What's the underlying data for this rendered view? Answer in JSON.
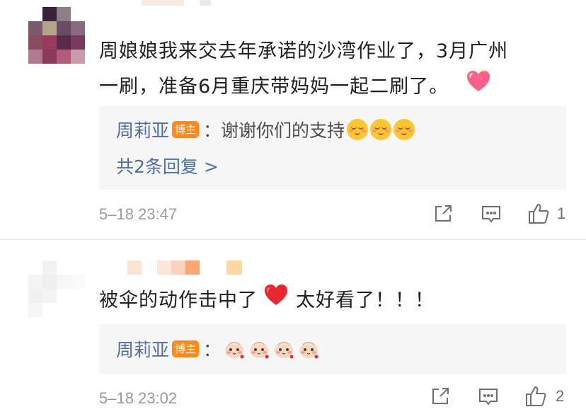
{
  "comments": [
    {
      "text_line1": "周娘娘我来交去年承诺的沙湾作业了，3月广州",
      "text_line2": "一刷，准备6月重庆带妈妈一起二刷了。",
      "reply": {
        "author": "周莉亚",
        "badge": "博主",
        "colon": "：",
        "text": "谢谢你们的支持",
        "emojis": [
          "smile-emoji",
          "smile-emoji",
          "smile-emoji"
        ]
      },
      "more_replies": "共2条回复 >",
      "timestamp": "5–18 23:47",
      "like_count": "1"
    },
    {
      "text_before_heart": "被伞的动作击中了",
      "text_after_heart": "太好看了！！！",
      "reply": {
        "author": "周莉亚",
        "badge": "博主",
        "colon": "：",
        "emojis": [
          "baozi-emoji",
          "baozi-emoji",
          "baozi-emoji",
          "baozi-emoji"
        ]
      },
      "timestamp": "5–18 23:02",
      "like_count": "2"
    }
  ],
  "icons": {
    "share": "share-icon",
    "comment": "comment-icon",
    "like": "thumbs-up-icon",
    "pink_heart": "pink-heart-icon",
    "red_heart": "red-heart-icon"
  },
  "colors": {
    "blogger_name": "#4e6ea3",
    "badge_bg": "#ff8a1e",
    "reply_bg": "#f6f6f6",
    "timestamp": "#9a9a9a"
  }
}
